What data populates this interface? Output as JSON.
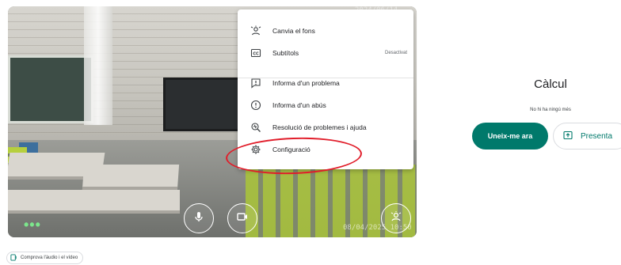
{
  "preview": {
    "timestamp_top": "2024/06/14",
    "timestamp": "08/04/2025 10:50"
  },
  "menu": {
    "items": [
      {
        "label": "Canvia el fons",
        "icon": "background-blur-icon"
      },
      {
        "label": "Subtítols",
        "icon": "closed-captions-icon",
        "status": "Desactivat"
      },
      {
        "label": "Informa d'un problema",
        "icon": "report-problem-icon"
      },
      {
        "label": "Informa d'un abús",
        "icon": "report-abuse-icon"
      },
      {
        "label": "Resolució de problemes i ajuda",
        "icon": "troubleshoot-icon"
      },
      {
        "label": "Configuració",
        "icon": "settings-gear-icon"
      }
    ]
  },
  "meeting": {
    "title": "Càlcul",
    "subtitle": "No hi ha ningú més",
    "join_label": "Uneix-me ara",
    "present_label": "Presenta"
  },
  "check_audio": {
    "label": "Comprova l'àudio i el vídeo"
  },
  "colors": {
    "accent": "#00796b",
    "annotation_red": "#e11d2a"
  }
}
